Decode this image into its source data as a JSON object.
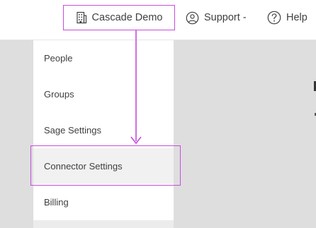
{
  "topbar": {
    "org_name": "Cascade Demo",
    "support_label": "Support -",
    "help_label": "Help",
    "icons": {
      "org": "building-icon",
      "support": "user-circle-icon",
      "help": "help-circle-icon"
    }
  },
  "dropdown": {
    "items": [
      {
        "label": "People"
      },
      {
        "label": "Groups"
      },
      {
        "label": "Sage Settings"
      },
      {
        "label": "Connector Settings"
      },
      {
        "label": "Billing"
      }
    ],
    "selected_index": 3
  },
  "colors": {
    "accent": "#c44ddb",
    "background": "#dedede",
    "menu_bg": "#ffffff",
    "selected_bg": "#f1f1f1",
    "text": "#3f3f3f"
  }
}
